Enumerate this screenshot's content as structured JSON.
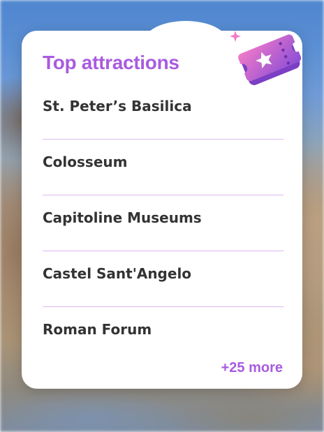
{
  "card": {
    "title": "Top attractions",
    "more_label": "+25 more",
    "icon": "ticket-icon"
  },
  "attractions": [
    {
      "name": "St. Peter’s Basilica"
    },
    {
      "name": "Colosseum"
    },
    {
      "name": "Capitoline Museums"
    },
    {
      "name": "Castel Sant'Angelo"
    },
    {
      "name": "Roman Forum"
    }
  ],
  "colors": {
    "accent": "#a85be0",
    "divider": "#dcb8f0",
    "text": "#333333",
    "card": "#ffffff"
  }
}
